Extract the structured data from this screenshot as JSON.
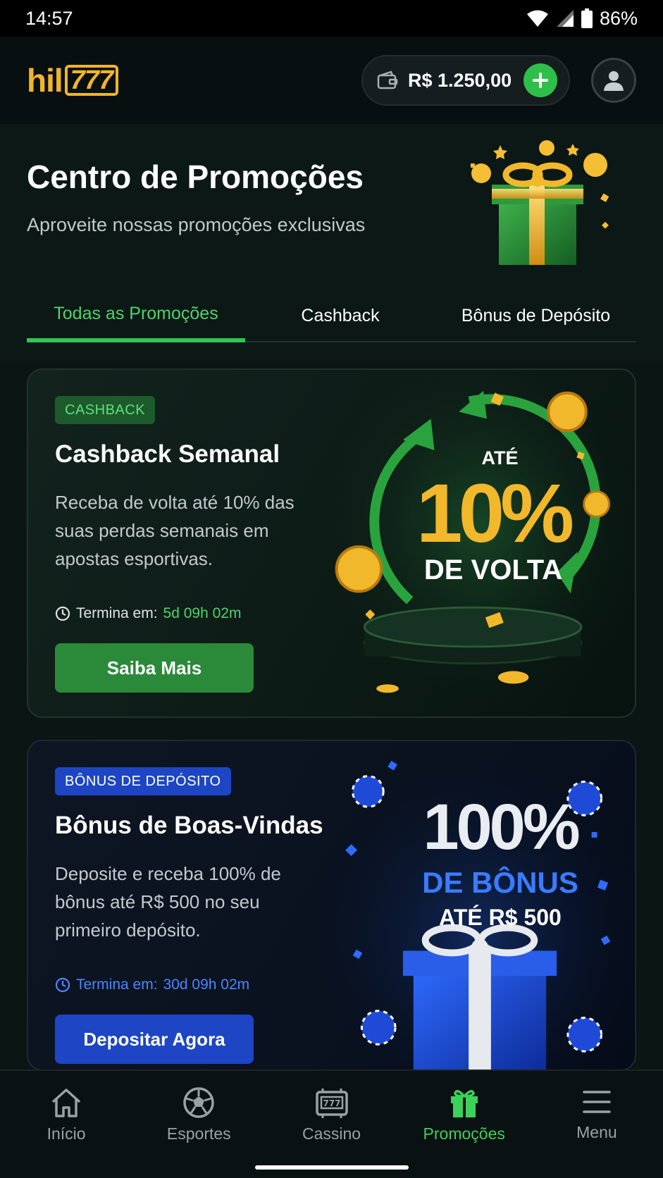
{
  "status_bar": {
    "time": "14:57",
    "battery": "86%"
  },
  "header": {
    "logo_text": "hil",
    "logo_box_text": "777",
    "balance": "R$ 1.250,00"
  },
  "hero": {
    "title": "Centro de Promoções",
    "subtitle": "Aproveite nossas promoções exclusivas"
  },
  "tabs": [
    {
      "label": "Todas as Promoções",
      "active": true
    },
    {
      "label": "Cashback",
      "active": false
    },
    {
      "label": "Bônus de Depósito",
      "active": false
    }
  ],
  "promotions": [
    {
      "badge": "CASHBACK",
      "title": "Cashback Semanal",
      "description": "Receba de volta até 10% das suas perdas semanais em apostas esportivas.",
      "deadline_label": "Termina em:",
      "deadline_value": "5d 09h 02m",
      "cta": "Saiba Mais",
      "art": {
        "line1": "ATÉ",
        "big": "10%",
        "line2": "DE VOLTA"
      }
    },
    {
      "badge": "BÔNUS DE DEPÓSITO",
      "title": "Bônus de Boas-Vindas",
      "description": "Deposite e receba 100% de bônus até R$ 500 no seu primeiro depósito.",
      "deadline_label": "Termina em:",
      "deadline_value": "30d 09h 02m",
      "cta": "Depositar Agora",
      "art": {
        "big": "100%",
        "line1": "DE BÔNUS",
        "line2": "ATÉ R$ 500"
      }
    }
  ],
  "bottom_nav": [
    {
      "label": "Início",
      "icon": "home-icon"
    },
    {
      "label": "Esportes",
      "icon": "soccer-ball-icon"
    },
    {
      "label": "Cassino",
      "icon": "slot-machine-icon"
    },
    {
      "label": "Promoções",
      "icon": "gift-icon",
      "active": true
    },
    {
      "label": "Menu",
      "icon": "hamburger-menu-icon"
    }
  ],
  "colors": {
    "accent_green": "#2fc650",
    "accent_blue": "#1e46c4",
    "gold": "#f0b52a"
  }
}
